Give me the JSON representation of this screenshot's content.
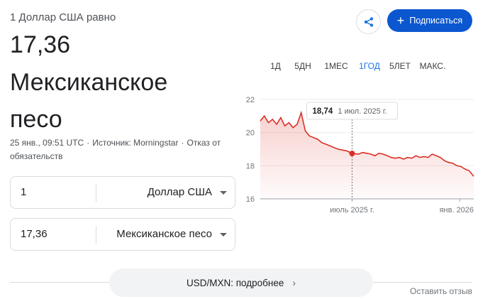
{
  "header": {
    "rate_line": "1 Доллар США равно",
    "value": "17,36",
    "currency_name": "Мексиканское песо",
    "timestamp": "25 янв., 09:51 UTC",
    "source": "Источник: Morningstar",
    "disclaimer": "Отказ от обязательств"
  },
  "actions": {
    "share_icon": "share-icon",
    "subscribe_label": "Подписаться"
  },
  "ranges": [
    "1Д",
    "5ДН",
    "1МЕС",
    "1ГОД",
    "5ЛЕТ",
    "МАКС."
  ],
  "active_range": "1ГОД",
  "converter": {
    "from": {
      "amount": "1",
      "unit": "Доллар США"
    },
    "to": {
      "amount": "17,36",
      "unit": "Мексиканское песо"
    }
  },
  "details_button": "USD/MXN: подробнее",
  "feedback_link": "Оставить отзыв",
  "colors": {
    "line": "#d93025",
    "accent": "#0b57d0",
    "active_tab": "#1a73e8"
  },
  "chart_data": {
    "type": "area",
    "title": "",
    "ylim": [
      16,
      22
    ],
    "yticks": [
      "22",
      "20",
      "18",
      "16"
    ],
    "x_labels": [
      "июль 2025 г.",
      "янв. 2026 г."
    ],
    "x": [
      "2025-01-25",
      "2025-02-01",
      "2025-02-08",
      "2025-02-15",
      "2025-02-22",
      "2025-03-01",
      "2025-03-08",
      "2025-03-15",
      "2025-03-22",
      "2025-03-29",
      "2025-04-05",
      "2025-04-12",
      "2025-04-19",
      "2025-04-26",
      "2025-05-03",
      "2025-05-10",
      "2025-05-17",
      "2025-05-24",
      "2025-05-31",
      "2025-06-07",
      "2025-06-14",
      "2025-06-21",
      "2025-06-28",
      "2025-07-01",
      "2025-07-12",
      "2025-07-19",
      "2025-07-26",
      "2025-08-02",
      "2025-08-09",
      "2025-08-16",
      "2025-08-23",
      "2025-08-30",
      "2025-09-06",
      "2025-09-13",
      "2025-09-20",
      "2025-09-27",
      "2025-10-04",
      "2025-10-11",
      "2025-10-18",
      "2025-10-25",
      "2025-11-01",
      "2025-11-08",
      "2025-11-15",
      "2025-11-22",
      "2025-11-29",
      "2025-12-06",
      "2025-12-13",
      "2025-12-20",
      "2025-12-27",
      "2026-01-03",
      "2026-01-10",
      "2026-01-17",
      "2026-01-25"
    ],
    "values": [
      20.7,
      21.0,
      20.6,
      20.8,
      20.5,
      20.9,
      20.4,
      20.6,
      20.3,
      20.5,
      21.2,
      20.1,
      19.8,
      19.7,
      19.6,
      19.4,
      19.3,
      19.2,
      19.1,
      19.0,
      18.95,
      18.9,
      18.8,
      18.74,
      18.7,
      18.8,
      18.75,
      18.7,
      18.6,
      18.75,
      18.7,
      18.6,
      18.5,
      18.45,
      18.5,
      18.4,
      18.5,
      18.45,
      18.6,
      18.5,
      18.55,
      18.5,
      18.7,
      18.6,
      18.5,
      18.3,
      18.2,
      18.15,
      18.0,
      17.95,
      17.8,
      17.7,
      17.36
    ],
    "tooltip": {
      "value": "18,74",
      "date": "1 июл. 2025 г."
    },
    "grid": true
  }
}
